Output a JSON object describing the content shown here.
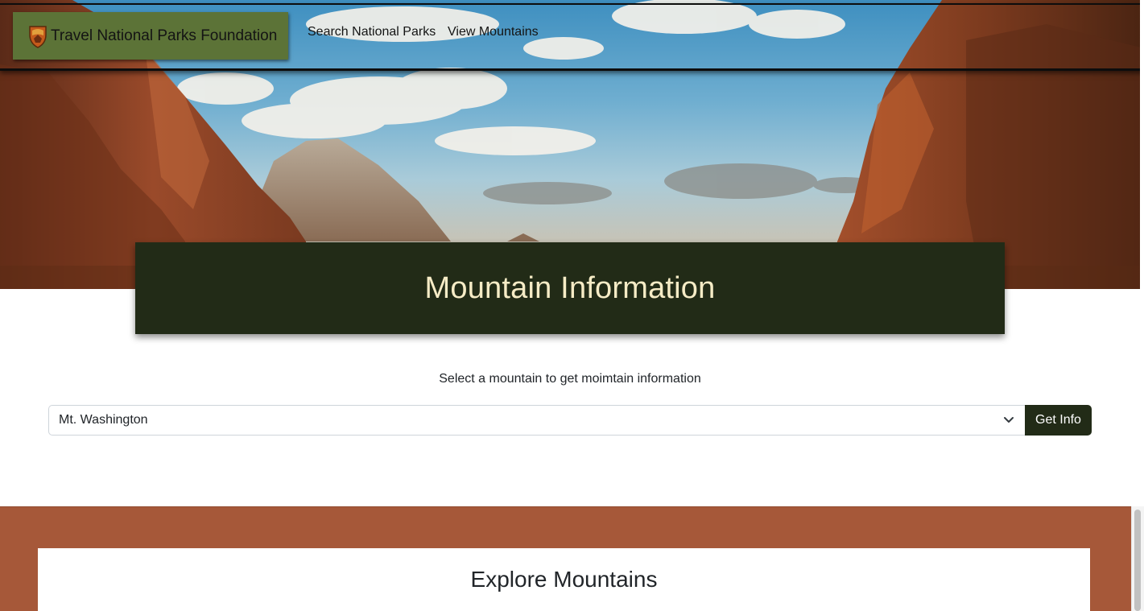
{
  "nav": {
    "brand": "Travel National Parks Foundation",
    "links": [
      "Search National Parks",
      "View Mountains"
    ]
  },
  "hero": {
    "title": "Mountain Information"
  },
  "form": {
    "prompt": "Select a mountain to get moimtain information",
    "selected": "Mt. Washington",
    "button": "Get Info"
  },
  "explore": {
    "title": "Explore Mountains"
  },
  "colors": {
    "brand_bg": "#5c7337",
    "title_bg": "#222b17",
    "title_text": "#f6ecc6",
    "button_bg": "#222b17",
    "explore_bg": "#a65839"
  },
  "icons": {
    "brand": "park-shield-icon",
    "select": "chevron-down-icon"
  }
}
